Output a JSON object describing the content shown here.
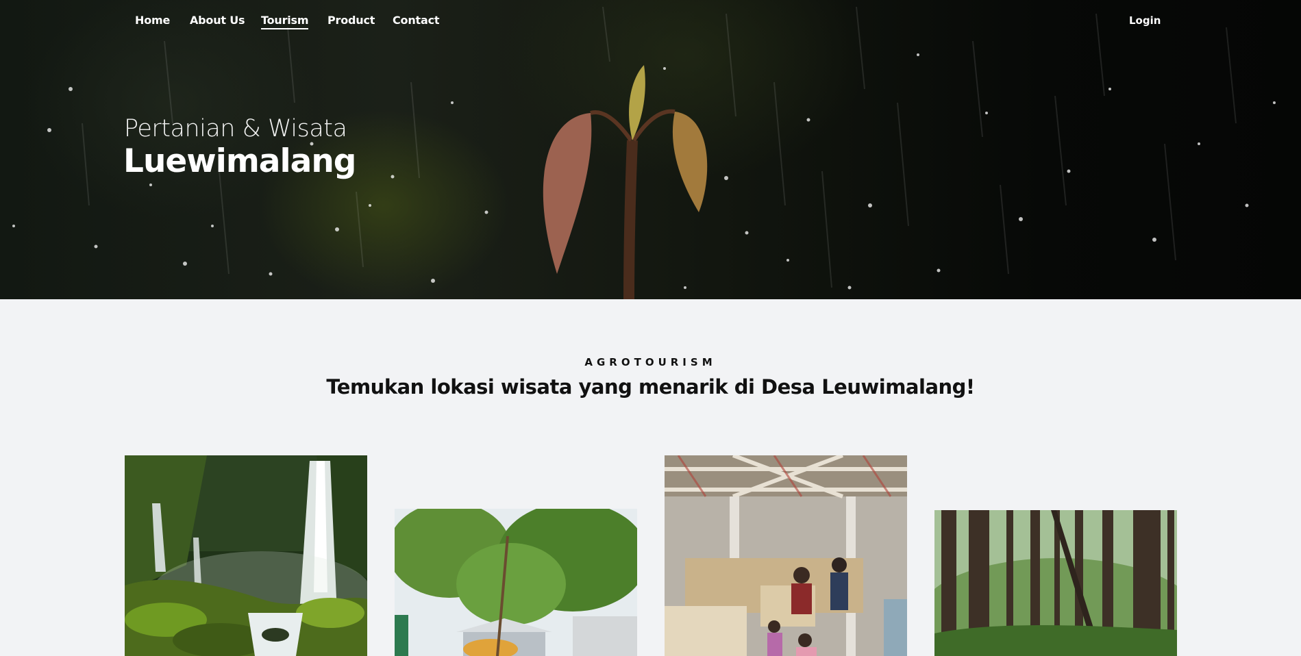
{
  "nav": {
    "items": [
      {
        "label": "Home"
      },
      {
        "label": "About Us"
      },
      {
        "label": "Tourism",
        "active": true
      },
      {
        "label": "Product"
      },
      {
        "label": "Contact"
      }
    ],
    "login_label": "Login"
  },
  "hero": {
    "subtitle": "Pertanian & Wisata",
    "title": "Luewimalang"
  },
  "section": {
    "label": "AGROTOURISM",
    "title": "Temukan lokasi wisata yang menarik di Desa Leuwimalang!"
  },
  "gallery": [
    {
      "icon": "waterfall-photo"
    },
    {
      "icon": "garden-photo"
    },
    {
      "icon": "craft-workshop-photo"
    },
    {
      "icon": "forest-photo"
    }
  ],
  "colors": {
    "hero_bg": "#0b0d0a",
    "page_bg": "#f2f3f5",
    "text_dark": "#111111",
    "nav_text": "#ffffff"
  }
}
